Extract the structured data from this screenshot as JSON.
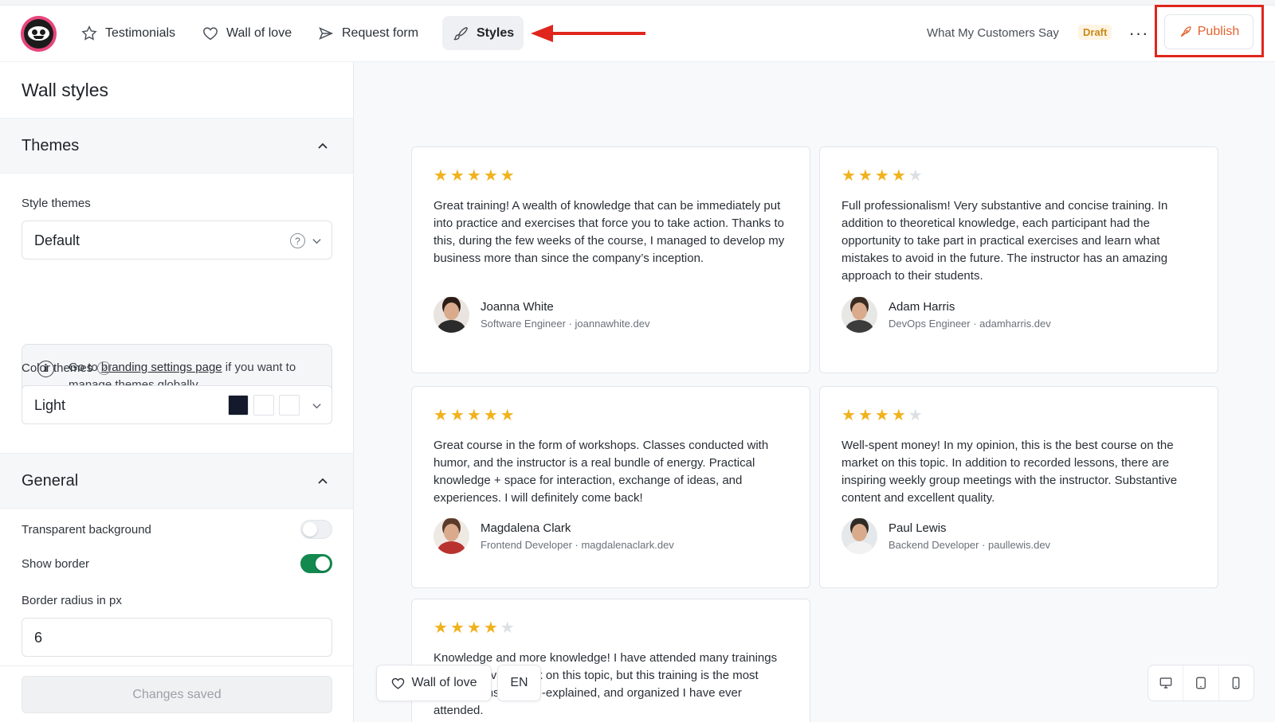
{
  "nav": {
    "testimonials": "Testimonials",
    "wall_of_love": "Wall of love",
    "request_form": "Request form",
    "styles": "Styles"
  },
  "header": {
    "site_title": "What My Customers Say",
    "status": "Draft",
    "more": "···",
    "publish": "Publish"
  },
  "colors": {
    "accent": "#e2622f",
    "annotation": "#e0261c",
    "toggle_on": "#13884f",
    "star": "#f0b21d"
  },
  "sidebar": {
    "title": "Wall styles",
    "themes": {
      "heading": "Themes",
      "style_label": "Style themes",
      "style_value": "Default",
      "info_prefix": "Go to ",
      "info_link": "branding settings page",
      "info_suffix": " if you want to manage themes globally",
      "color_label": "Color themes",
      "color_value": "Light",
      "swatches": [
        "#141a2b",
        "#ffffff",
        "#ffffff"
      ]
    },
    "general": {
      "heading": "General",
      "transparent_bg": "Transparent background",
      "transparent_bg_on": false,
      "show_border": "Show border",
      "show_border_on": true,
      "radius_label": "Border radius in px",
      "radius_value": "6"
    },
    "footer_button": "Changes saved"
  },
  "testimonials": [
    {
      "rating": 5,
      "text": "Great training! A wealth of knowledge that can be immediately put into practice and exercises that force you to take action. Thanks to this, during the few weeks of the course, I managed to develop my business more than since the company’s inception.",
      "name": "Joanna White",
      "meta": "Software Engineer · joannawhite.dev"
    },
    {
      "rating": 4,
      "text": "Full professionalism! Very substantive and concise training. In addition to theoretical knowledge, each participant had the opportunity to take part in practical exercises and learn what mistakes to avoid in the future. The instructor has an amazing approach to their students.",
      "name": "Adam Harris",
      "meta": "DevOps Engineer · adamharris.dev"
    },
    {
      "rating": 5,
      "text": "Great course in the form of workshops. Classes conducted with humor, and the instructor is a real bundle of energy. Practical knowledge + space for interaction, exchange of ideas, and experiences. I will definitely come back!",
      "name": "Magdalena Clark",
      "meta": "Frontend Developer · magdalenaclark.dev"
    },
    {
      "rating": 4,
      "text": "Well-spent money! In my opinion, this is the best course on the market on this topic. In addition to recorded lessons, there are inspiring weekly group meetings with the instructor. Substantive content and excellent quality.",
      "name": "Paul Lewis",
      "meta": "Backend Developer · paullewis.dev"
    },
    {
      "rating": 4,
      "text": "Knowledge and more knowledge! I have attended many trainings and read every book on this topic, but this training is the most comprehensive, well-explained, and organized I have ever attended."
    }
  ],
  "floating": {
    "wall_button": "Wall of love",
    "language": "EN"
  },
  "devices": [
    "desktop-icon",
    "tablet-icon",
    "mobile-icon"
  ]
}
